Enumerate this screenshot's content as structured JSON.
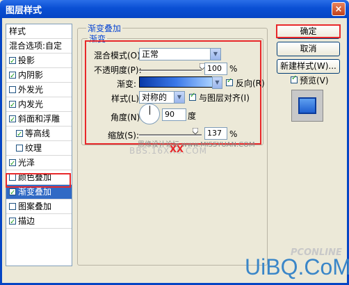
{
  "window": {
    "title": "图层样式",
    "close_glyph": "×"
  },
  "style_list": {
    "header": "样式",
    "blend_label": "混合选项:自定",
    "items": [
      {
        "label": "投影",
        "checked": true
      },
      {
        "label": "内阴影",
        "checked": true
      },
      {
        "label": "外发光",
        "checked": false
      },
      {
        "label": "内发光",
        "checked": true
      },
      {
        "label": "斜面和浮雕",
        "checked": true
      },
      {
        "label": "等高线",
        "checked": true
      },
      {
        "label": "纹理",
        "checked": false
      },
      {
        "label": "光泽",
        "checked": true
      },
      {
        "label": "颜色叠加",
        "checked": false
      },
      {
        "label": "渐变叠加",
        "checked": true
      },
      {
        "label": "图案叠加",
        "checked": false
      },
      {
        "label": "描边",
        "checked": true
      }
    ]
  },
  "panel": {
    "group_title": "渐变叠加",
    "subgroup_title": "渐变",
    "blend_mode": {
      "label": "混合模式(O):",
      "value": "正常"
    },
    "opacity": {
      "label": "不透明度(P):",
      "value": "100",
      "unit": "%",
      "level": 1.0
    },
    "gradient": {
      "label": "渐变:",
      "reverse_label": "反向(R)",
      "reverse_checked": true
    },
    "style": {
      "label": "样式(L):",
      "value": "对称的",
      "align_label": "与图层对齐(I)",
      "align_checked": true
    },
    "angle": {
      "label": "角度(N):",
      "value": "90",
      "unit": "度"
    },
    "scale": {
      "label": "缩放(S):",
      "value": "137",
      "unit": "%",
      "level": 0.91
    }
  },
  "watermark": {
    "line1": "思缘设计论坛  www.MISSYUAN.COM",
    "line2": "BBS.16XX8.COM",
    "line2_xx": "XX"
  },
  "buttons": {
    "ok": "确定",
    "cancel": "取消",
    "new_style": "新建样式(W)...",
    "preview_label": "预览(V)",
    "preview_checked": true
  },
  "logos": {
    "pconline": "PCONLINE",
    "uibq": "UiBQ.CoM"
  },
  "colors": {
    "accent_blue": "#0a46d2",
    "highlight_red": "#e8282a",
    "selection": "#316ac5"
  }
}
